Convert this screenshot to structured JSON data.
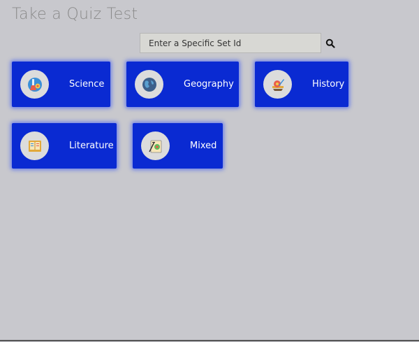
{
  "page": {
    "title": "Take a Quiz Test"
  },
  "search": {
    "placeholder": "Enter a Specific Set Id",
    "value": "",
    "icon": "search-icon"
  },
  "categories": [
    {
      "label": "Science",
      "icon": "science-icon"
    },
    {
      "label": "Geography",
      "icon": "globe-icon"
    },
    {
      "label": "History",
      "icon": "history-icon"
    },
    {
      "label": "Literature",
      "icon": "book-icon"
    },
    {
      "label": "Mixed",
      "icon": "mixed-icon"
    }
  ],
  "colors": {
    "card": "#0a2ad2",
    "background": "#c8c8cd",
    "title": "#8a8a8a"
  }
}
